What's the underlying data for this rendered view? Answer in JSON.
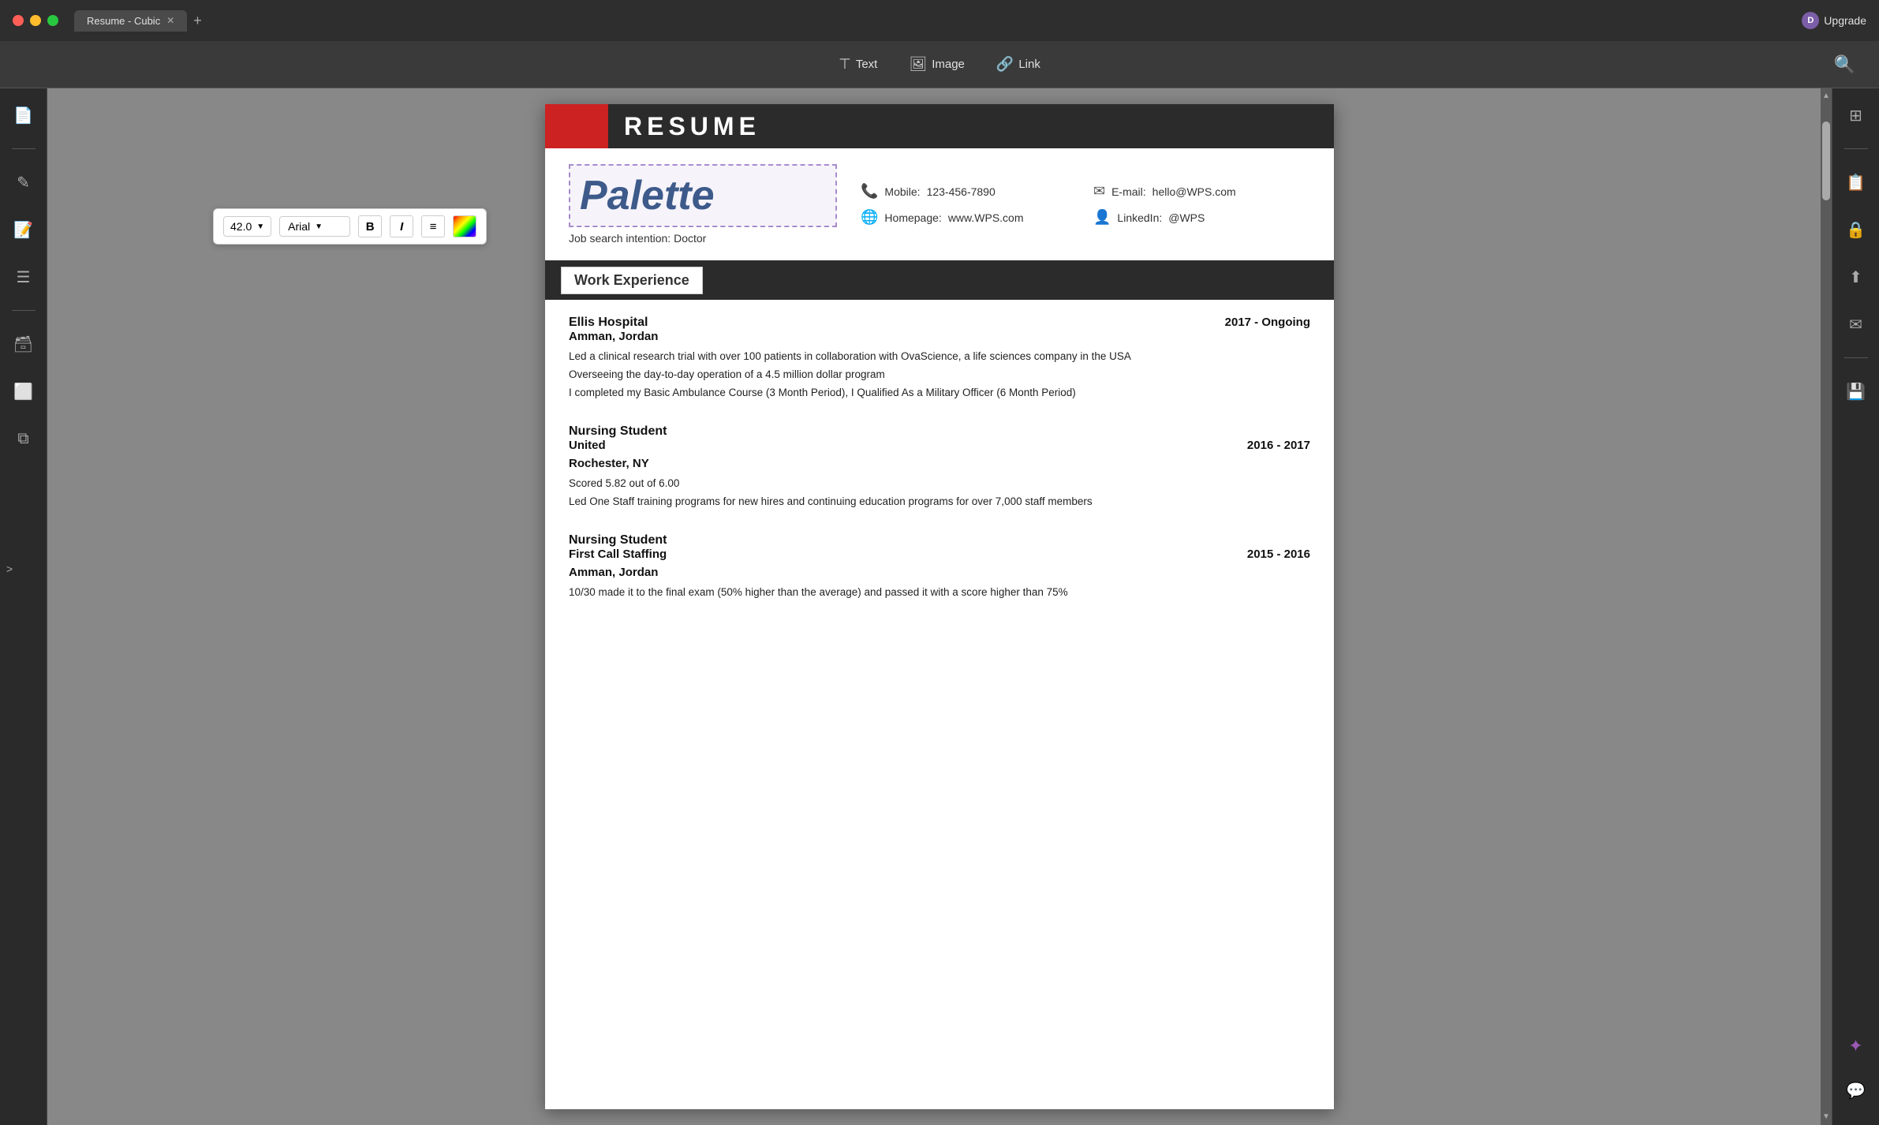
{
  "titlebar": {
    "tab_title": "Resume - Cubic",
    "upgrade_label": "Upgrade",
    "avatar_letter": "D"
  },
  "toolbar": {
    "text_label": "Text",
    "image_label": "Image",
    "link_label": "Link"
  },
  "format_toolbar": {
    "font_size": "42.0",
    "font_family": "Arial",
    "bold_label": "B",
    "italic_label": "I",
    "align_label": "≡"
  },
  "resume": {
    "title": "RESUME",
    "name": "Palette",
    "job_intention_label": "Job search intention:",
    "job_intention_value": "Doctor",
    "mobile_label": "Mobile:",
    "mobile_value": "123-456-7890",
    "email_label": "E-mail:",
    "email_value": "hello@WPS.com",
    "homepage_label": "Homepage:",
    "homepage_value": "www.WPS.com",
    "linkedin_label": "LinkedIn:",
    "linkedin_value": "@WPS",
    "sections": [
      {
        "title": "Work Experience",
        "entries": [
          {
            "company": "Ellis Hospital",
            "dates": "2017 - Ongoing",
            "location": "Amman,  Jordan",
            "descriptions": [
              "Led a  clinical research trial with over 100 patients in collaboration with OvaScience, a life sciences company in the USA",
              "Overseeing the day-to-day operation of a 4.5 million dollar program",
              "I completed my Basic Ambulance Course (3 Month Period), I Qualified As a Military Officer (6 Month Period)"
            ]
          },
          {
            "company": "Nursing Student",
            "company2": "United",
            "dates": "2016 - 2017",
            "location": "Rochester, NY",
            "descriptions": [
              "Scored 5.82 out of 6.00",
              "Led  One  Staff  training  programs  for  new hires and continuing education programs for over 7,000 staff members"
            ]
          },
          {
            "company": "Nursing Student",
            "company2": "First Call Staffing",
            "dates": "2015 - 2016",
            "location": "Amman,  Jordan",
            "descriptions": [
              "10/30  made it to the final exam (50% higher than the average) and passed it with a score  higher than 75%"
            ]
          }
        ]
      }
    ]
  },
  "sidebar_left": {
    "icons": [
      {
        "name": "document-icon",
        "symbol": "📄",
        "active": false
      },
      {
        "name": "edit-icon",
        "symbol": "✏️",
        "active": false
      },
      {
        "name": "text-edit-icon",
        "symbol": "📝",
        "active": true
      },
      {
        "name": "list-icon",
        "symbol": "📋",
        "active": false
      },
      {
        "name": "image-icon",
        "symbol": "🖼️",
        "active": false
      },
      {
        "name": "template-icon",
        "symbol": "⬜",
        "active": false
      },
      {
        "name": "copy-icon",
        "symbol": "📑",
        "active": false
      }
    ]
  },
  "sidebar_right": {
    "icons": [
      {
        "name": "scan-icon",
        "symbol": "⊞"
      },
      {
        "name": "file-check-icon",
        "symbol": "📋"
      },
      {
        "name": "lock-file-icon",
        "symbol": "🔒"
      },
      {
        "name": "share-icon",
        "symbol": "↑"
      },
      {
        "name": "mail-icon",
        "symbol": "✉"
      },
      {
        "name": "save-icon",
        "symbol": "💾"
      },
      {
        "name": "ai-icon",
        "symbol": "✦"
      },
      {
        "name": "chat-icon",
        "symbol": "💬"
      }
    ]
  }
}
